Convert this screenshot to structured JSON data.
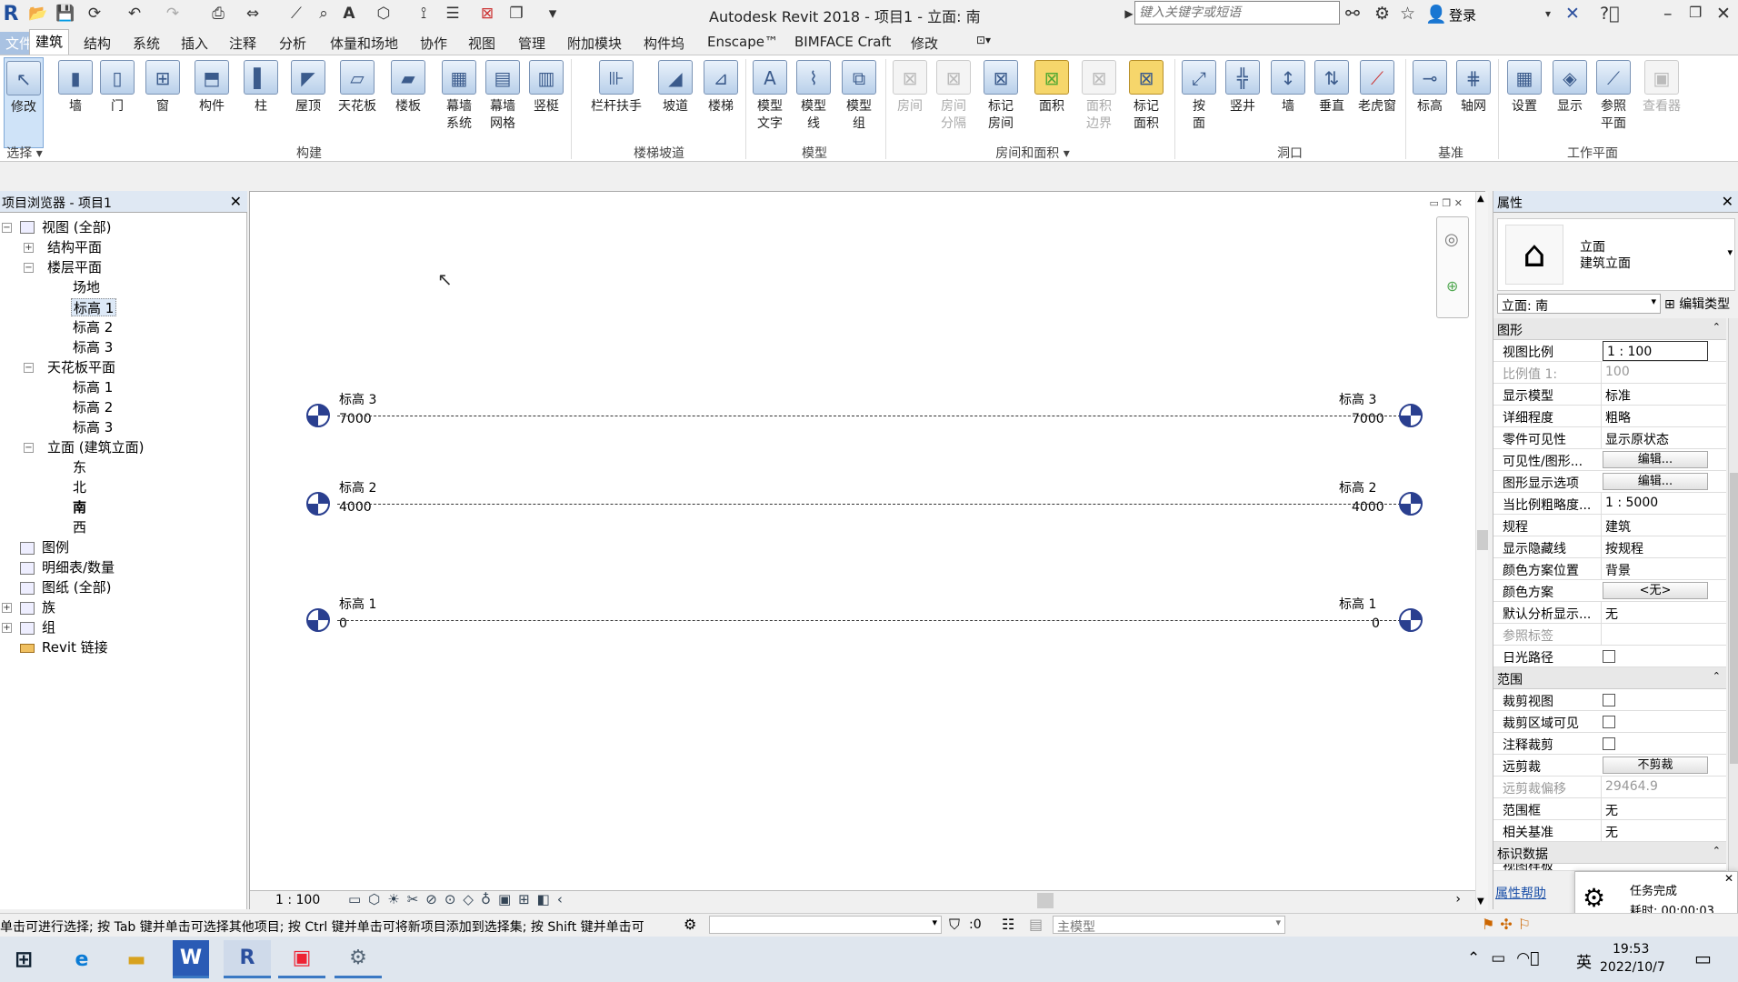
{
  "app": {
    "title": "Autodesk Revit 2018 -    项目1 - 立面: 南",
    "search_placeholder": "键入关键字或短语",
    "login": "登录",
    "logo": "R"
  },
  "menu_tabs": [
    "文件",
    "建筑",
    "结构",
    "系统",
    "插入",
    "注释",
    "分析",
    "体量和场地",
    "协作",
    "视图",
    "管理",
    "附加模块",
    "构件坞",
    "Enscape™",
    "BIMFACE Craft",
    "修改"
  ],
  "active_tab": "建筑",
  "ribbon": {
    "select_label": "选择",
    "buttons": [
      {
        "label": "修改",
        "icon": "cursor-icon"
      },
      {
        "label": "墙",
        "icon": "wall-icon"
      },
      {
        "label": "门",
        "icon": "door-icon"
      },
      {
        "label": "窗",
        "icon": "window-icon"
      },
      {
        "label": "构件",
        "icon": "component-icon"
      },
      {
        "label": "柱",
        "icon": "column-icon"
      },
      {
        "label": "屋顶",
        "icon": "roof-icon"
      },
      {
        "label": "天花板",
        "icon": "ceiling-icon"
      },
      {
        "label": "楼板",
        "icon": "floor-icon"
      },
      {
        "label": "幕墙\n系统",
        "icon": "curtain-system-icon"
      },
      {
        "label": "幕墙\n网格",
        "icon": "curtain-grid-icon"
      },
      {
        "label": "竖梃",
        "icon": "mullion-icon"
      },
      {
        "label": "栏杆扶手",
        "icon": "railing-icon"
      },
      {
        "label": "坡道",
        "icon": "ramp-icon"
      },
      {
        "label": "楼梯",
        "icon": "stair-icon"
      },
      {
        "label": "模型\n文字",
        "icon": "model-text-icon"
      },
      {
        "label": "模型\n线",
        "icon": "model-line-icon"
      },
      {
        "label": "模型\n组",
        "icon": "model-group-icon"
      },
      {
        "label": "房间",
        "icon": "room-icon"
      },
      {
        "label": "房间\n分隔",
        "icon": "room-separator-icon"
      },
      {
        "label": "标记\n房间",
        "icon": "tag-room-icon"
      },
      {
        "label": "面积",
        "icon": "area-icon"
      },
      {
        "label": "面积\n边界",
        "icon": "area-boundary-icon"
      },
      {
        "label": "标记\n面积",
        "icon": "tag-area-icon"
      },
      {
        "label": "按\n面",
        "icon": "by-face-icon"
      },
      {
        "label": "竖井",
        "icon": "shaft-icon"
      },
      {
        "label": "墙",
        "icon": "wall-opening-icon"
      },
      {
        "label": "垂直",
        "icon": "vertical-icon"
      },
      {
        "label": "老虎窗",
        "icon": "dormer-icon"
      },
      {
        "label": "标高",
        "icon": "level-icon"
      },
      {
        "label": "轴网",
        "icon": "grid-icon"
      },
      {
        "label": "设置",
        "icon": "set-icon"
      },
      {
        "label": "显示",
        "icon": "show-icon"
      },
      {
        "label": "参照\n平面",
        "icon": "ref-plane-icon"
      },
      {
        "label": "查看器",
        "icon": "viewer-icon"
      }
    ],
    "groups": [
      "构建",
      "楼梯坡道",
      "模型",
      "房间和面积",
      "洞口",
      "基准",
      "工作平面"
    ]
  },
  "project_browser": {
    "title": "项目浏览器 - 项目1",
    "tree": [
      {
        "label": "视图 (全部)"
      },
      {
        "label": "结构平面"
      },
      {
        "label": "楼层平面"
      },
      {
        "label": "场地"
      },
      {
        "label": "标高 1"
      },
      {
        "label": "标高 2"
      },
      {
        "label": "标高 3"
      },
      {
        "label": "天花板平面"
      },
      {
        "label": "标高 1"
      },
      {
        "label": "标高 2"
      },
      {
        "label": "标高 3"
      },
      {
        "label": "立面 (建筑立面)"
      },
      {
        "label": "东"
      },
      {
        "label": "北"
      },
      {
        "label": "南"
      },
      {
        "label": "西"
      },
      {
        "label": "图例"
      },
      {
        "label": "明细表/数量"
      },
      {
        "label": "图纸 (全部)"
      },
      {
        "label": "族"
      },
      {
        "label": "组"
      },
      {
        "label": "Revit 链接"
      }
    ]
  },
  "levels": [
    {
      "name": "标高 3",
      "elevation": "7000"
    },
    {
      "name": "标高 2",
      "elevation": "4000"
    },
    {
      "name": "标高 1",
      "elevation": "0"
    }
  ],
  "view_control": {
    "scale": "1 : 100"
  },
  "properties": {
    "title": "属性",
    "type_name": "立面",
    "type_sub": "建筑立面",
    "selector": "立面: 南",
    "edit_type": "编辑类型",
    "sections": {
      "graphics": "图形",
      "extents": "范围",
      "identity": "标识数据",
      "identity_first": "视图样板"
    },
    "graphics": [
      {
        "label": "视图比例",
        "value": "1 : 100"
      },
      {
        "label": "比例值 1:",
        "value": "100"
      },
      {
        "label": "显示模型",
        "value": "标准"
      },
      {
        "label": "详细程度",
        "value": "粗略"
      },
      {
        "label": "零件可见性",
        "value": "显示原状态"
      },
      {
        "label": "可见性/图形...",
        "value": "编辑..."
      },
      {
        "label": "图形显示选项",
        "value": "编辑..."
      },
      {
        "label": "当比例粗略度...",
        "value": "1 : 5000"
      },
      {
        "label": "规程",
        "value": "建筑"
      },
      {
        "label": "显示隐藏线",
        "value": "按规程"
      },
      {
        "label": "颜色方案位置",
        "value": "背景"
      },
      {
        "label": "颜色方案",
        "value": "<无>"
      },
      {
        "label": "默认分析显示...",
        "value": "无"
      },
      {
        "label": "参照标签",
        "value": ""
      },
      {
        "label": "日光路径",
        "value": ""
      }
    ],
    "extents": [
      {
        "label": "裁剪视图",
        "value": ""
      },
      {
        "label": "裁剪区域可见",
        "value": ""
      },
      {
        "label": "注释裁剪",
        "value": ""
      },
      {
        "label": "远剪裁",
        "value": "不剪裁"
      },
      {
        "label": "远剪裁偏移",
        "value": "29464.9"
      },
      {
        "label": "范围框",
        "value": "无"
      },
      {
        "label": "相关基准",
        "value": "无"
      }
    ],
    "help": "属性帮助"
  },
  "status": {
    "message": "单击可进行选择; 按 Tab 键并单击可选择其他项目; 按 Ctrl 键并单击可将新项目添加到选择集; 按 Shift 键并单击可",
    "count": ":0",
    "model": "主模型"
  },
  "toast": {
    "title": "任务完成",
    "time": "耗时: 00:00:03"
  },
  "taskbar": {
    "time": "19:53",
    "date": "2022/10/7",
    "ime": "英"
  }
}
